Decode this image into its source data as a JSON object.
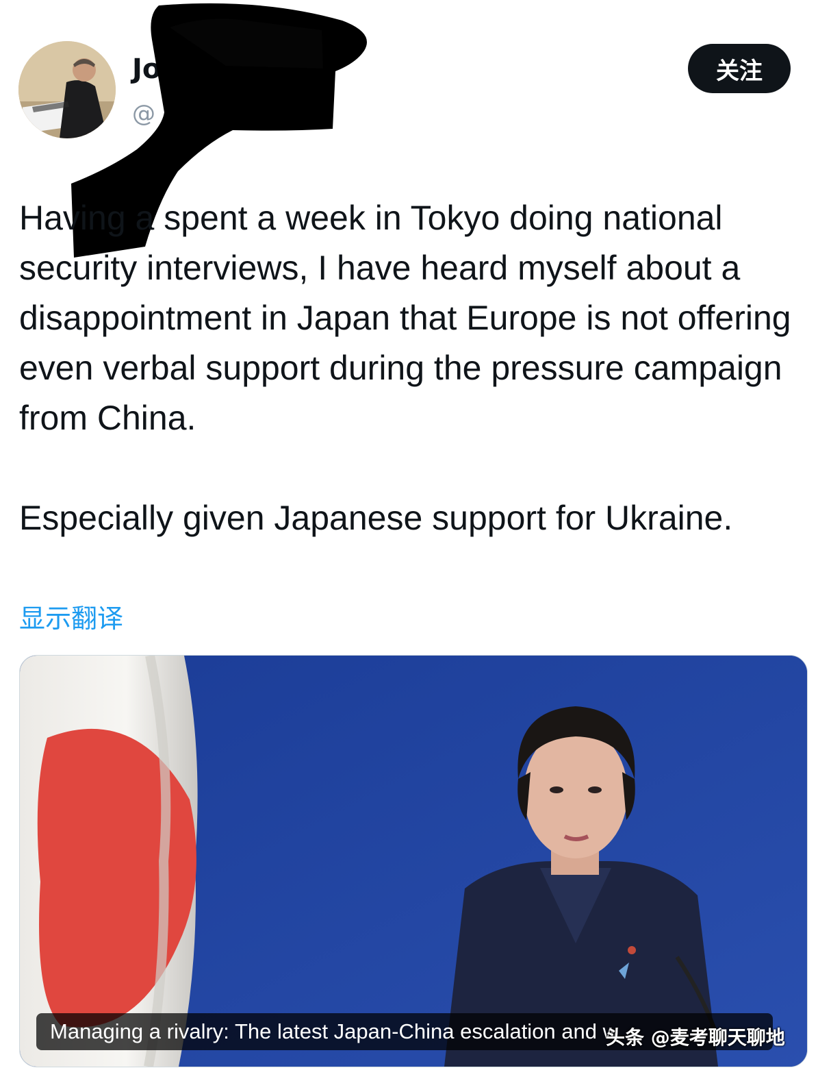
{
  "header": {
    "display_name": "Jo",
    "handle": "@",
    "follow_label": "关注"
  },
  "tweet": {
    "paragraphs": [
      "Having a spent a week in Tokyo doing national security interviews, I have heard myself about a disappointment in Japan that Europe is not offering even verbal support during the pressure campaign from China.",
      "Especially given Japanese support for Ukraine."
    ],
    "translate_label": "显示翻译"
  },
  "media": {
    "caption": "Managing a rivalry: The latest Japan-China escalation and w"
  },
  "watermark": "头条 @麦考聊天聊地",
  "colors": {
    "follow_bg": "#0f1419",
    "link": "#1d9bf0",
    "backdrop": "#1f3f98",
    "flag_red": "#e0473f"
  }
}
